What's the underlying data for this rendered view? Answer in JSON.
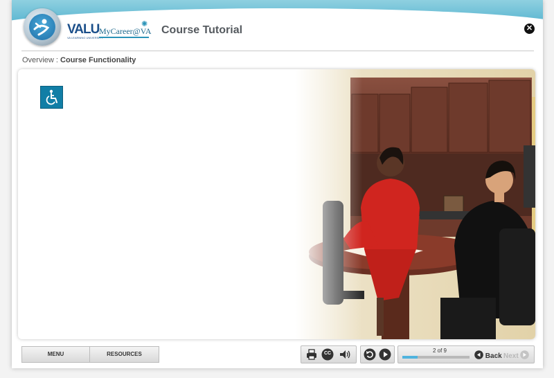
{
  "header": {
    "brand_valu": "VALU",
    "brand_valu_sub": "VA LEARNING UNIVERSITY",
    "brand_mycareer": "MyCareer@VA",
    "title": "Course Tutorial"
  },
  "breadcrumb": {
    "parent": "Overview",
    "separator": ":",
    "current": "Course Functionality"
  },
  "icons": {
    "close": "close-icon",
    "accessibility": "wheelchair-icon",
    "print": "printer-icon",
    "cc": "closed-captions-icon",
    "audio": "speaker-icon",
    "replay": "replay-icon",
    "play": "play-icon",
    "back": "back-arrow-icon",
    "next": "next-arrow-icon"
  },
  "toolbar": {
    "menu_label": "MENU",
    "resources_label": "RESOURCES",
    "cc_label": "CC",
    "progress_text": "2 of 9",
    "progress_fraction": 0.222,
    "back_label": "Back",
    "next_label": "Next"
  },
  "colors": {
    "accent": "#117ea6",
    "progress_fill": "#4fb3de",
    "title_text": "#555a5f",
    "disabled_text": "#b8b8b8"
  }
}
